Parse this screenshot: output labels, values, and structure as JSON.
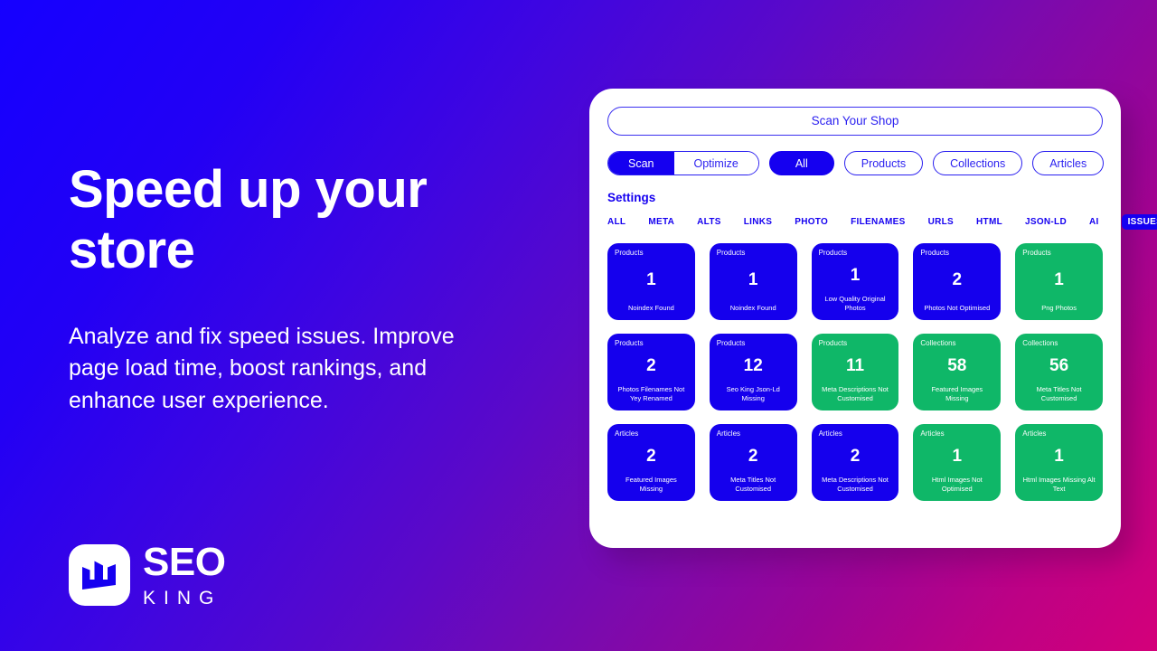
{
  "promo": {
    "headline": "Speed up your store",
    "body": "Analyze and fix speed issues. Improve page load time, boost rankings, and enhance user experience."
  },
  "logo": {
    "mark_icon": "bar-chart-crown-icon",
    "name_primary": "SEO",
    "name_secondary": "KING"
  },
  "app": {
    "scan_shop_button": "Scan Your Shop",
    "mode_toggle": {
      "options": [
        "Scan",
        "Optimize"
      ],
      "selected": "Scan"
    },
    "resource_filters": {
      "options": [
        "All",
        "Products",
        "Collections",
        "Articles"
      ],
      "selected": "All"
    },
    "settings_title": "Settings",
    "filter_tabs": {
      "options": [
        "ALL",
        "META",
        "ALTS",
        "LINKS",
        "PHOTO",
        "FILENAMES",
        "URLS",
        "HTML",
        "JSON-LD",
        "AI",
        "ISSUES"
      ],
      "selected": "ISSUES"
    },
    "cards": [
      {
        "scope": "Products",
        "count": "1",
        "label": "Noindex Found",
        "color": "blue"
      },
      {
        "scope": "Products",
        "count": "1",
        "label": "Noindex Found",
        "color": "blue"
      },
      {
        "scope": "Products",
        "count": "1",
        "label": "Low Quality Original Photos",
        "color": "blue"
      },
      {
        "scope": "Products",
        "count": "2",
        "label": "Photos Not Optimised",
        "color": "blue"
      },
      {
        "scope": "Products",
        "count": "1",
        "label": "Png Photos",
        "color": "green"
      },
      {
        "scope": "Products",
        "count": "2",
        "label": "Photos Filenames Not Yey Renamed",
        "color": "blue"
      },
      {
        "scope": "Products",
        "count": "12",
        "label": "Seo King Json-Ld Missing",
        "color": "blue"
      },
      {
        "scope": "Products",
        "count": "11",
        "label": "Meta Descriptions Not Customised",
        "color": "green"
      },
      {
        "scope": "Collections",
        "count": "58",
        "label": "Featured Images Missing",
        "color": "green"
      },
      {
        "scope": "Collections",
        "count": "56",
        "label": "Meta Titles Not Customised",
        "color": "green"
      },
      {
        "scope": "Articles",
        "count": "2",
        "label": "Featured Images Missing",
        "color": "blue"
      },
      {
        "scope": "Articles",
        "count": "2",
        "label": "Meta Titles Not Customised",
        "color": "blue"
      },
      {
        "scope": "Articles",
        "count": "2",
        "label": "Meta Descriptions Not Customised",
        "color": "blue"
      },
      {
        "scope": "Articles",
        "count": "1",
        "label": "Html Images Not Optimised",
        "color": "green"
      },
      {
        "scope": "Articles",
        "count": "1",
        "label": "Html Images Missing Alt Text",
        "color": "green"
      }
    ]
  },
  "colors": {
    "brand_blue": "#1500f0",
    "brand_green": "#0fb768",
    "gradient_start": "#1500ff",
    "gradient_end": "#d4007a",
    "panel_bg": "#ffffff"
  }
}
